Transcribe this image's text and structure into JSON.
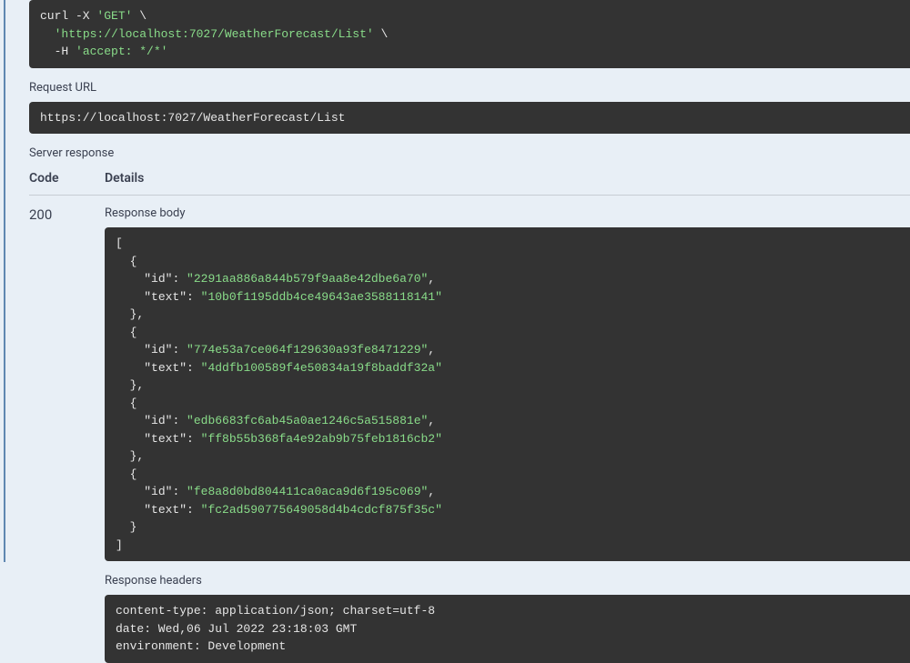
{
  "curl": {
    "line1_pre": "curl -X ",
    "method": "'GET'",
    "line1_post": " \\",
    "line2_pre": "  ",
    "url": "'https://localhost:7027/WeatherForecast/List'",
    "line2_post": " \\",
    "line3_pre": "  -H ",
    "header": "'accept: */*'"
  },
  "labels": {
    "request_url": "Request URL",
    "server_response": "Server response",
    "code": "Code",
    "details": "Details",
    "response_body": "Response body",
    "response_headers": "Response headers"
  },
  "request_url": "https://localhost:7027/WeatherForecast/List",
  "response": {
    "status_code": "200",
    "body_items": [
      {
        "id": "2291aa886a844b579f9aa8e42dbe6a70",
        "text": "10b0f1195ddb4ce49643ae3588118141"
      },
      {
        "id": "774e53a7ce064f129630a93fe8471229",
        "text": "4ddfb100589f4e50834a19f8baddf32a"
      },
      {
        "id": "edb6683fc6ab45a0ae1246c5a515881e",
        "text": "ff8b55b368fa4e92ab9b75feb1816cb2"
      },
      {
        "id": "fe8a8d0bd804411ca0aca9d6f195c069",
        "text": "fc2ad590775649058d4b4cdcf875f35c"
      }
    ],
    "headers": [
      "content-type: application/json; charset=utf-8 ",
      "date: Wed,06 Jul 2022 23:18:03 GMT ",
      "environment: Development "
    ]
  }
}
